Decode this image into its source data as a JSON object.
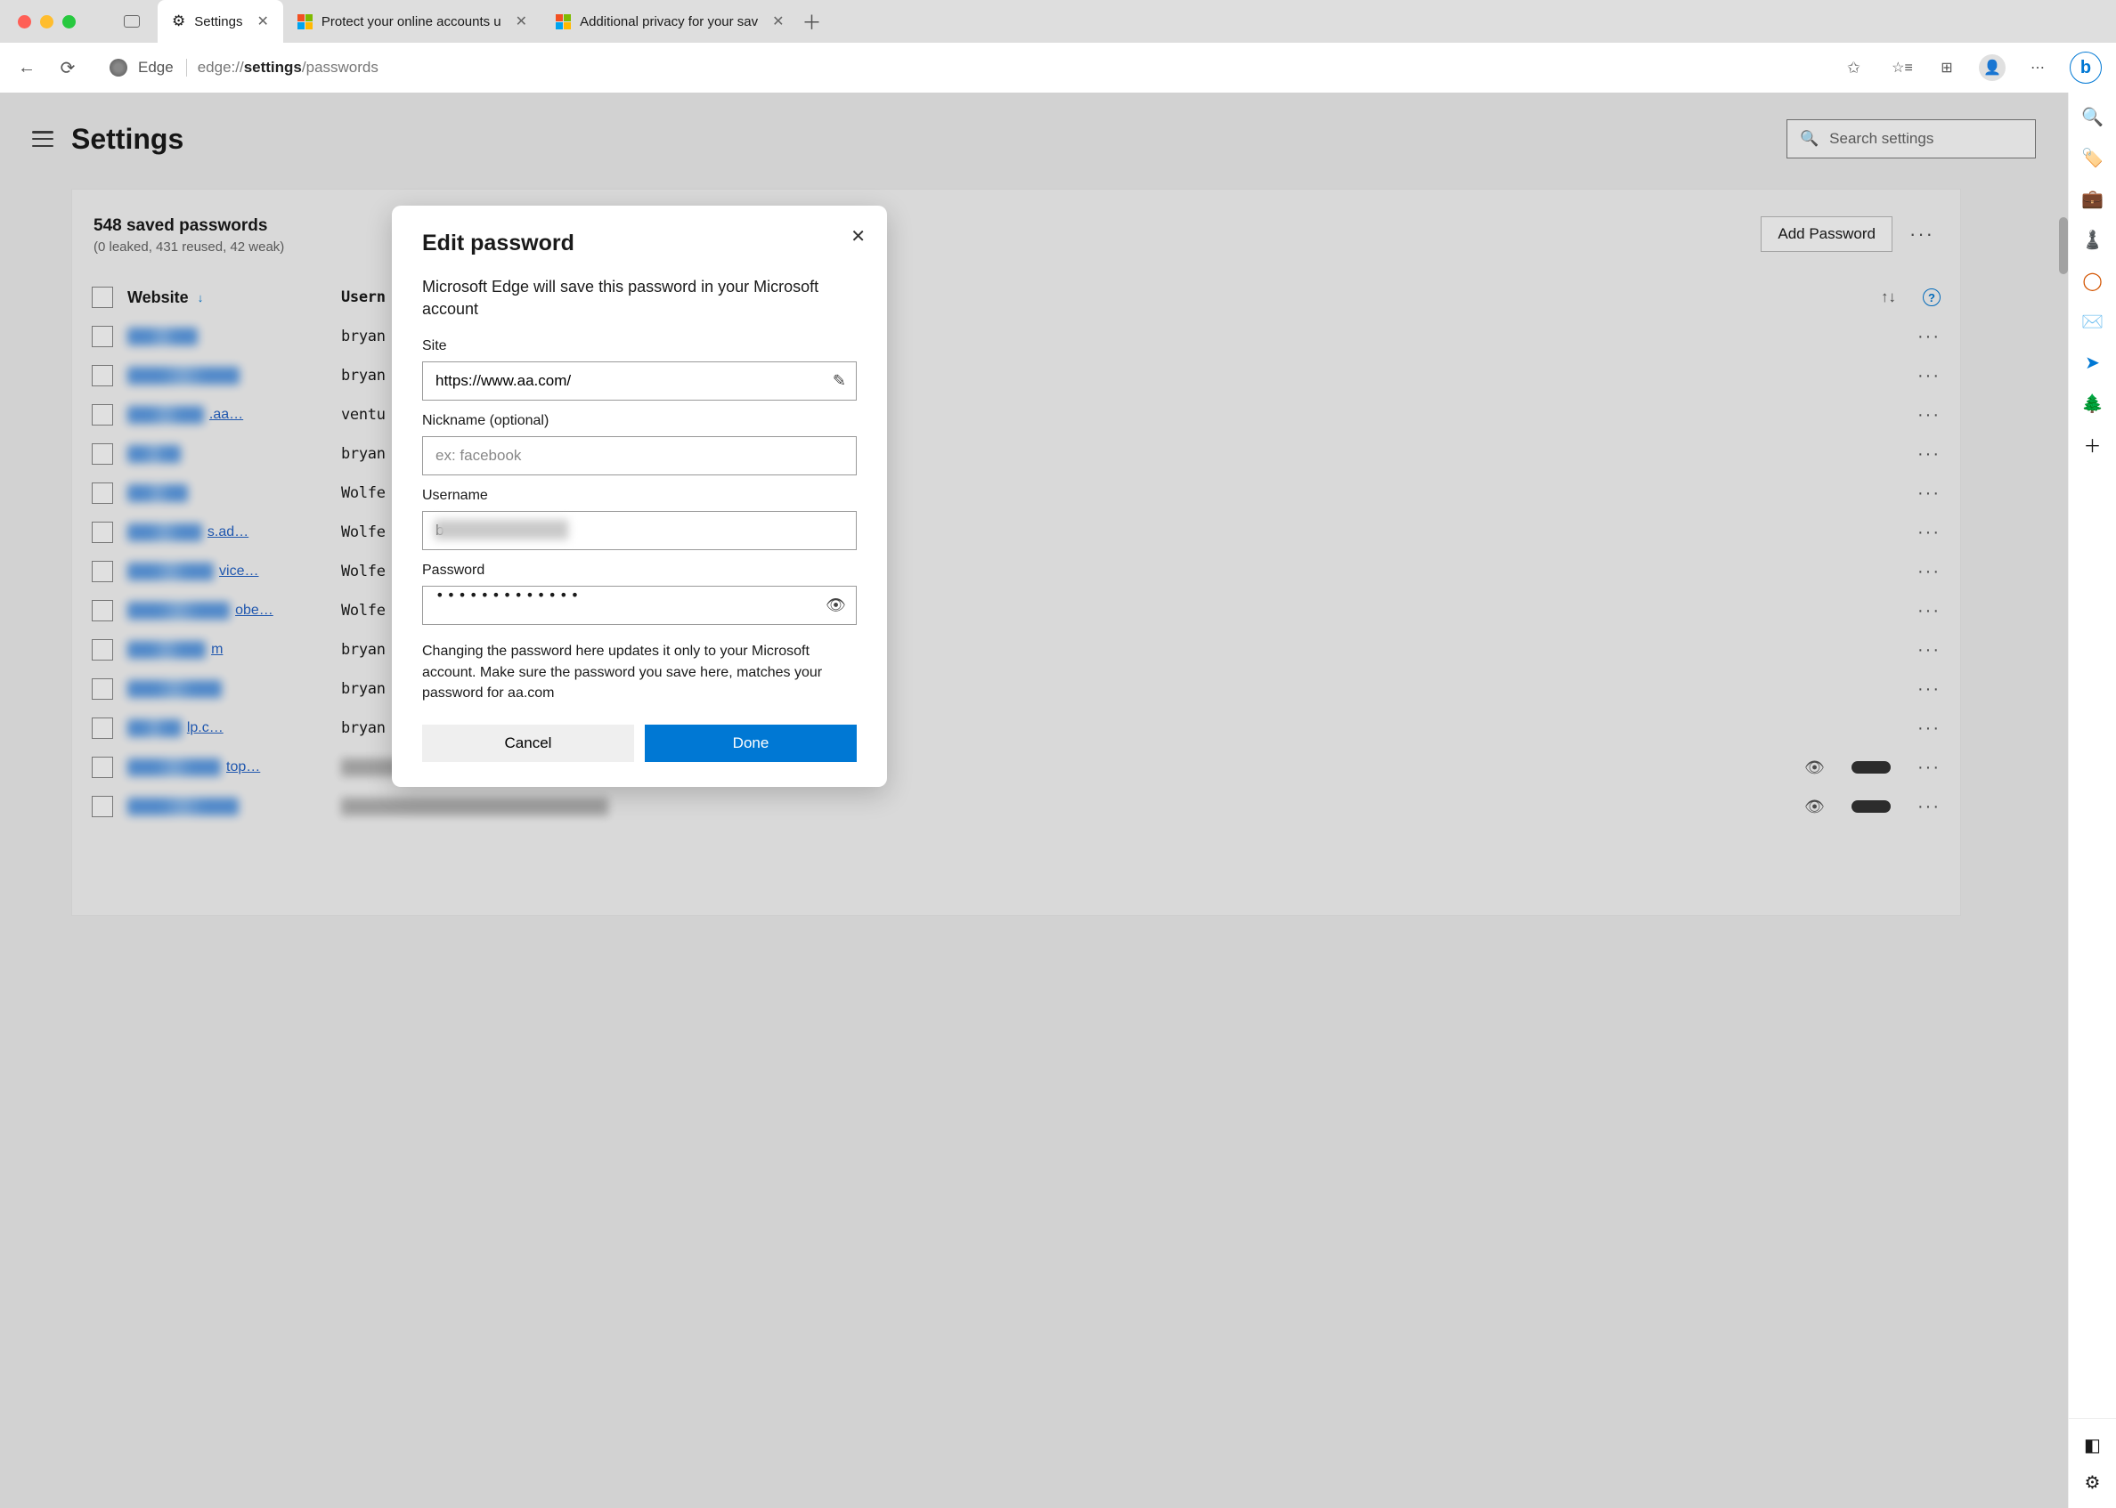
{
  "window": {
    "tabs": [
      {
        "label": "Settings",
        "active": true
      },
      {
        "label": "Protect your online accounts u",
        "active": false
      },
      {
        "label": "Additional privacy for your sav",
        "active": false
      }
    ]
  },
  "toolbar": {
    "edge_label": "Edge",
    "url_prefix": "edge://",
    "url_bold": "settings",
    "url_suffix": "/passwords"
  },
  "settings": {
    "title": "Settings",
    "search_placeholder": "Search settings"
  },
  "panel": {
    "saved_title": "548 saved passwords",
    "saved_sub": "(0 leaked, 431 reused, 42 weak)",
    "add_button": "Add Password",
    "columns": {
      "website": "Website",
      "username": "Usern"
    },
    "rows": [
      {
        "suffix": "",
        "user": "bryan"
      },
      {
        "suffix": "",
        "user": "bryan"
      },
      {
        "suffix": ".aa…",
        "user": "ventu"
      },
      {
        "suffix": "",
        "user": "bryan"
      },
      {
        "suffix": "",
        "user": "Wolfe"
      },
      {
        "suffix": "s.ad…",
        "user": "Wolfe"
      },
      {
        "suffix": "vice…",
        "user": "Wolfe"
      },
      {
        "suffix": "obe…",
        "user": "Wolfe"
      },
      {
        "suffix": "m",
        "user": "bryan"
      },
      {
        "suffix": "",
        "user": "bryan"
      },
      {
        "suffix": "lp.c…",
        "user": "bryan"
      },
      {
        "suffix": "top…",
        "user": "",
        "gray": true,
        "showExtras": true
      },
      {
        "suffix": "",
        "user": "",
        "gray": true,
        "showExtras": true
      }
    ]
  },
  "modal": {
    "title": "Edit password",
    "lead": "Microsoft Edge will save this password in your Microsoft account",
    "site_label": "Site",
    "site_value": "https://www.aa.com/",
    "nickname_label": "Nickname (optional)",
    "nickname_placeholder": "ex: facebook",
    "username_label": "Username",
    "username_value_prefix": "b",
    "password_label": "Password",
    "password_dots": "•••••••••••••",
    "footer_text": "Changing the password here updates it only to your Microsoft account. Make sure the password you save here, matches your password for aa.com",
    "cancel": "Cancel",
    "done": "Done"
  },
  "siderail": {
    "icons": [
      "search",
      "tag",
      "briefcase",
      "games",
      "office",
      "outlook",
      "send",
      "tree",
      "plus"
    ]
  }
}
